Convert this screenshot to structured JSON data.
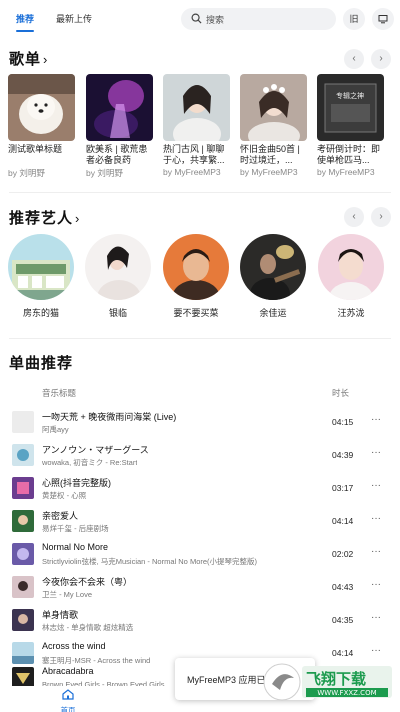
{
  "tabs": {
    "recommend": "推荐",
    "latest": "最新上传"
  },
  "search": {
    "placeholder": "搜索",
    "btn1": "旧",
    "btn2": "▭"
  },
  "playlists": {
    "title": "歌单",
    "items": [
      {
        "name": "测试歌单标题",
        "by": "by 刘明野"
      },
      {
        "name": "欧美系 | 歌荒患者必备良药",
        "by": "by 刘明野"
      },
      {
        "name": "热门古风 | 聊聊于心，共享繁...",
        "by": "by MyFreeMP3"
      },
      {
        "name": "怀旧金曲50首 | 时过境迁，...",
        "by": "by MyFreeMP3"
      },
      {
        "name": "考研倒计时：即使单枪匹马...",
        "by": "by MyFreeMP3"
      }
    ],
    "cover4_text": "专辑之神"
  },
  "artists": {
    "title": "推荐艺人",
    "items": [
      {
        "name": "房东的猫"
      },
      {
        "name": "银临"
      },
      {
        "name": "要不要买菜"
      },
      {
        "name": "余佳运"
      },
      {
        "name": "汪苏泷"
      }
    ]
  },
  "songs": {
    "title": "单曲推荐",
    "col_title": "音乐标题",
    "col_duration": "时长",
    "items": [
      {
        "title": "一吻天荒 + 晚夜微雨问海棠 (Live)",
        "sub": "阿禹ayy",
        "dur": "04:15"
      },
      {
        "title": "アンノウン・マザーグース",
        "sub": "wowaka, 初音ミク - Re:Start",
        "dur": "04:39"
      },
      {
        "title": "心照(抖音完整版)",
        "sub": "黄楚权 - 心照",
        "dur": "03:17"
      },
      {
        "title": "亲密爱人",
        "sub": "易烊千玺 - 后座剧场",
        "dur": "04:14"
      },
      {
        "title": "Normal No More",
        "sub": "Strictlyviolin弦楼, 马克Musician - Normal No More(小提琴完整版)",
        "dur": "02:02"
      },
      {
        "title": "今夜你会不会来（粤）",
        "sub": "卫兰 - My Love",
        "dur": "04:43"
      },
      {
        "title": "单身情歌",
        "sub": "林志炫 - 单身情歌 超炫精选",
        "dur": "04:35"
      },
      {
        "title": "Across the wind",
        "sub": "塞王明月-MSR - Across the wind",
        "dur": "04:14"
      },
      {
        "title": "Abracadabra",
        "sub": "Brown Eyed Girls - Brown Eyed Girls",
        "dur": ""
      }
    ],
    "more": "···"
  },
  "bottom": {
    "home": "首页"
  },
  "toast": {
    "text": "MyFreeMP3 应用已"
  },
  "watermark": {
    "text": "飞翔下载",
    "url": "WWW.FXXZ.COM"
  },
  "colors": {
    "accent": "#1a6fd8"
  }
}
